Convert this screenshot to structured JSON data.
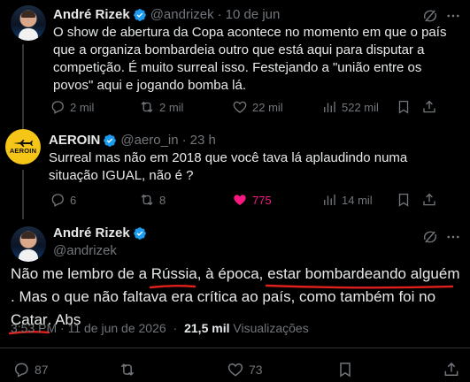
{
  "posts": [
    {
      "name": "André Rizek",
      "handle": "@andrizek",
      "sep": "·",
      "time": "10 de jun",
      "text": "O show de abertura da Copa acontece no momento em que o país que a organiza bombardeia outro que está aqui para disputar a competição. É muito surreal isso. Festejando a \"união entre os povos\" aqui e jogando bomba lá.",
      "replies": "2 mil",
      "reposts": "2 mil",
      "likes": "22 mil",
      "views": "522 mil"
    },
    {
      "name": "AEROIN",
      "handle": "@aero_in",
      "sep": "·",
      "time": "23 h",
      "avatar_text": "AEROIN",
      "text": "Surreal mas não em 2018 que você tava lá aplaudindo numa situação IGUAL, não é ?",
      "replies": "6",
      "reposts": "8",
      "likes": "775",
      "views": "14 mil"
    }
  ],
  "main_post": {
    "name": "André Rizek",
    "handle": "@andrizek",
    "text_parts": [
      "Não me lembro de a ",
      "Rússia",
      ", à época, ",
      "estar bombardeando alguém",
      ". Mas o que não faltava era crítica ao país, como também foi no ",
      "Catar",
      ". Abs"
    ],
    "timestamp": "3:53 PM · 11 de jun de 2026",
    "meta_sep": "·",
    "views_count": "21,5 mil",
    "views_label": "Visualizações",
    "replies": "87",
    "reposts": "",
    "likes": "73"
  },
  "colors": {
    "background": "#000000",
    "text": "#e7e9ea",
    "muted": "#71767b",
    "verified": "#1d9bf0",
    "like_active": "#f91880",
    "annotation": "#e0201b",
    "aeroin_brand": "#f5c518"
  },
  "icons": [
    "grok-icon",
    "more-icon",
    "reply-icon",
    "repost-icon",
    "like-icon",
    "views-icon",
    "bookmark-icon",
    "share-icon",
    "verified-icon"
  ]
}
